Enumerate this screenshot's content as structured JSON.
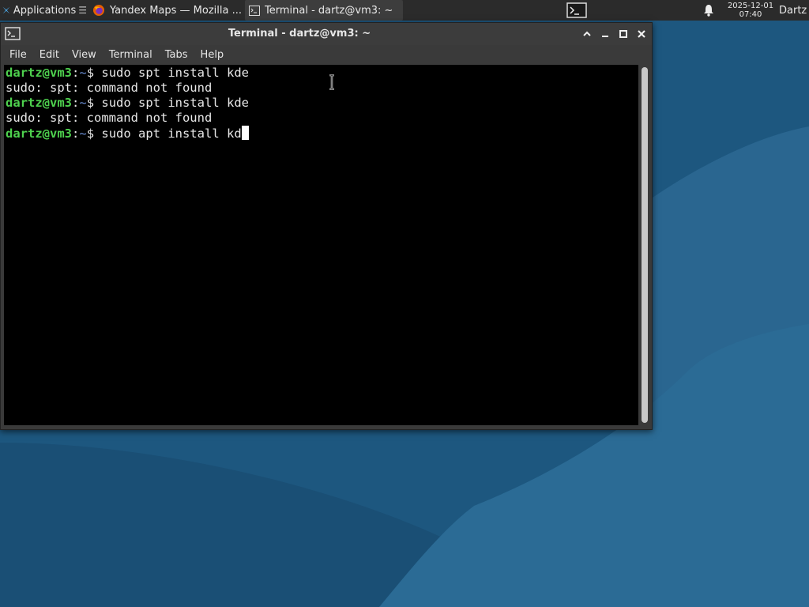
{
  "panel": {
    "applications_label": "Applications",
    "tasks": [
      {
        "label": "Yandex Maps — Mozilla ...",
        "icon": "firefox-icon"
      },
      {
        "label": "Terminal - dartz@vm3: ~",
        "icon": "terminal-icon"
      }
    ],
    "clock_date": "2025-12-01",
    "clock_time": "07:40",
    "user": "Dartz"
  },
  "window": {
    "title": "Terminal - dartz@vm3: ~",
    "menu": [
      "File",
      "Edit",
      "View",
      "Terminal",
      "Tabs",
      "Help"
    ]
  },
  "terminal": {
    "lines": [
      {
        "type": "prompt",
        "user": "dartz@vm3",
        "path": "~",
        "symbol": "$",
        "command": " sudo spt install kde"
      },
      {
        "type": "output",
        "text": "sudo: spt: command not found"
      },
      {
        "type": "prompt",
        "user": "dartz@vm3",
        "path": "~",
        "symbol": "$",
        "command": " sudo spt install kde"
      },
      {
        "type": "output",
        "text": "sudo: spt: command not found"
      },
      {
        "type": "prompt",
        "user": "dartz@vm3",
        "path": "~",
        "symbol": "$",
        "command": " sudo apt install kd",
        "cursor": true
      }
    ]
  },
  "colors": {
    "desktop": "#1f5a82",
    "prompt_user": "#4ed14e",
    "prompt_path": "#6a8fd6",
    "terminal_bg": "#000000"
  }
}
